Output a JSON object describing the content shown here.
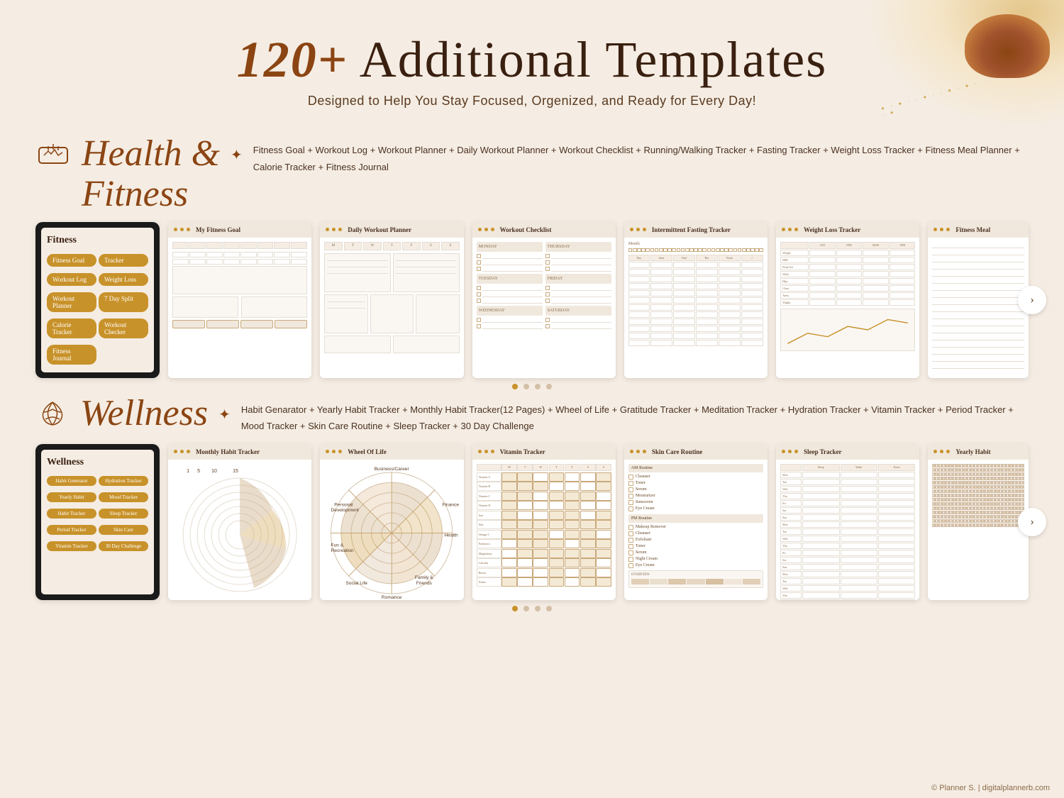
{
  "page": {
    "background_color": "#f5ede3",
    "title_highlight": "120+",
    "title_rest": " Additional Templates",
    "subtitle": "Designed to Help You Stay Focused, Orgenized, and Ready for Every Day!",
    "copyright": "© Planner S. | digitalplannerb.com"
  },
  "sections": {
    "health": {
      "icon": "🏋️",
      "title_line1": "Health &",
      "title_line2": "Fitness",
      "tags": "Fitness Goal + Workout Log + Workout Planner + Daily Workout Planner + Workout Checklist + Running/Walking Tracker + Fasting Tracker + Weight Loss Tracker + Fitness Meal Planner + Calorie Tracker + Fitness Journal",
      "cards": [
        {
          "id": "fitness-tablet",
          "type": "tablet",
          "title": "Fitness"
        },
        {
          "id": "fitness-goal",
          "title": "My Fitness Goal"
        },
        {
          "id": "daily-workout",
          "title": "Daily Workout Planner"
        },
        {
          "id": "workout-checklist",
          "title": "Workout Checklist"
        },
        {
          "id": "fasting-tracker",
          "title": "Intermittent Fasting Tracker"
        },
        {
          "id": "weight-loss",
          "title": "Weight Loss Tracker"
        },
        {
          "id": "fitness-meal",
          "title": "Fitness Meal"
        }
      ]
    },
    "wellness": {
      "icon": "🪷",
      "title": "Wellness",
      "tags": "Habit Genarator + Yearly Habit Tracker + Monthly Habit Tracker(12 Pages) + Wheel of Life + Gratitude Tracker + Meditation Tracker + Hydration Tracker + Vitamin Tracker + Period Tracker + Mood Tracker + Skin Care Routine + Sleep Tracker + 30 Day Challenge",
      "cards": [
        {
          "id": "wellness-tablet",
          "type": "tablet",
          "title": "Wellness"
        },
        {
          "id": "monthly-habit",
          "title": "Monthly Habit Tracker"
        },
        {
          "id": "wheel-of-life",
          "title": "Wheel Of Life"
        },
        {
          "id": "vitamin-tracker",
          "title": "Vitamin Tracker"
        },
        {
          "id": "skin-care",
          "title": "Skin Care Routine"
        },
        {
          "id": "sleep-tracker",
          "title": "Sleep Tracker"
        },
        {
          "id": "yearly-habit",
          "title": "Yearly Habit"
        }
      ]
    }
  },
  "pagination": {
    "health": {
      "active": 0,
      "total": 4
    },
    "wellness": {
      "active": 0,
      "total": 4
    }
  },
  "labels": {
    "next_arrow": "›",
    "wheel_sections": [
      "Business/Career",
      "Finance",
      "Health",
      "Family & Friends",
      "Romance",
      "Social Life",
      "Fun & Recreation",
      "Personal Development"
    ]
  }
}
